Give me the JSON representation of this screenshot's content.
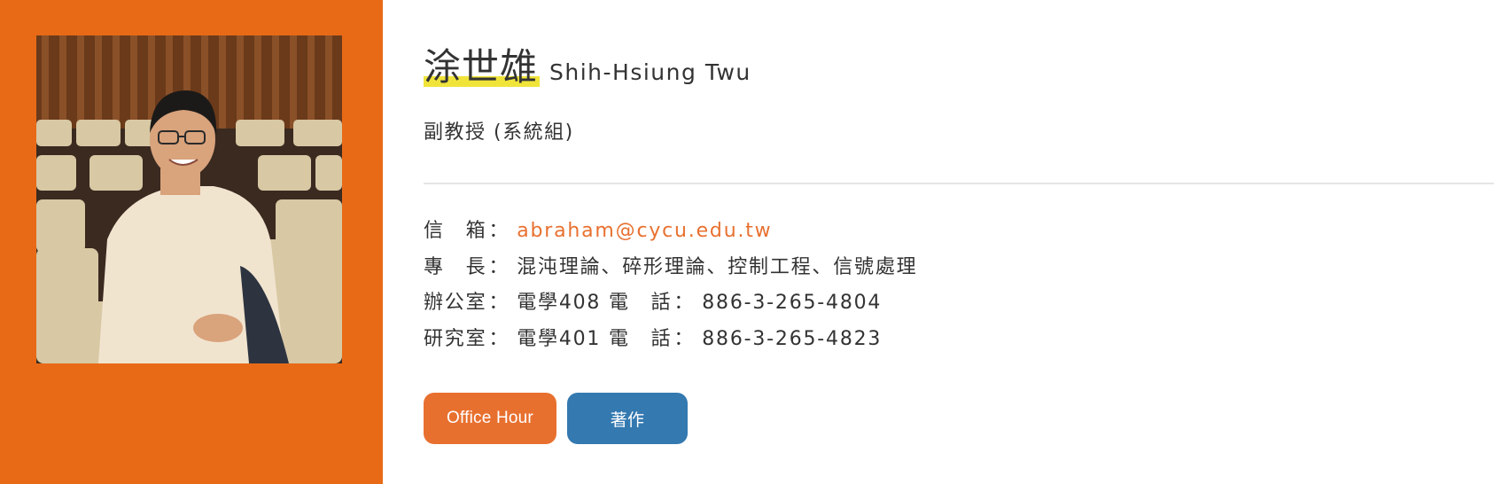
{
  "colors": {
    "sidebar": "#e86a17",
    "accent": "#e8702f",
    "highlight": "#f0e43a",
    "button_primary": "#e8702f",
    "button_secondary": "#3479b0"
  },
  "profile": {
    "name_cn": "涂世雄",
    "name_en": "Shih-Hsiung Twu",
    "title": "副教授 (系統組)",
    "photo_icon": "portrait-photo"
  },
  "info": {
    "email_label": "信　箱",
    "email": "abraham@cycu.edu.tw",
    "specialty_label": "專　長",
    "specialty": "混沌理論、碎形理論、控制工程、信號處理",
    "office_label": "辦公室",
    "office_room": "電學408",
    "office_phone_label": "電　話",
    "office_phone": "886-3-265-4804",
    "lab_label": "研究室",
    "lab_room": "電學401",
    "lab_phone_label": "電　話",
    "lab_phone": "886-3-265-4823",
    "colon": "："
  },
  "buttons": {
    "office_hour": "Office Hour",
    "publications": "著作"
  }
}
